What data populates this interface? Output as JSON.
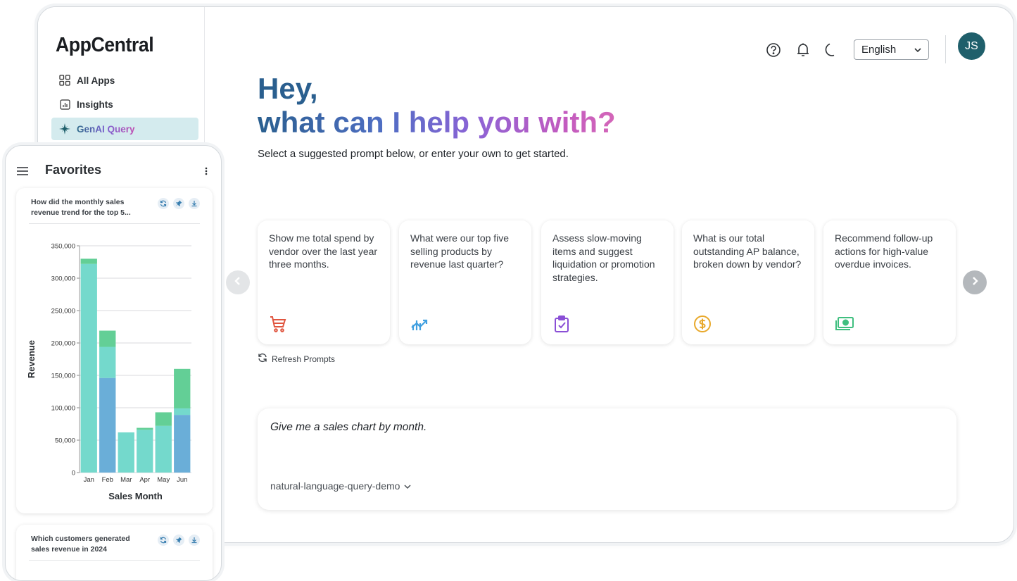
{
  "app": {
    "name": "AppCentral"
  },
  "sidebar": {
    "items": [
      {
        "label": "All Apps",
        "icon": "grid-icon"
      },
      {
        "label": "Insights",
        "icon": "chart-icon"
      },
      {
        "label": "GenAI Query",
        "icon": "sparkle-icon",
        "active": true
      }
    ]
  },
  "header": {
    "language": "English",
    "avatar_initials": "JS",
    "icons": [
      "help-icon",
      "bell-icon",
      "moon-icon"
    ]
  },
  "hero": {
    "greeting_line1": "Hey,",
    "greeting_line2": "what can I help you with?",
    "subtitle": "Select a suggested prompt below, or enter your own to get started."
  },
  "prompts": [
    {
      "text": "Show me total spend by vendor over the last year three months.",
      "icon": "cart-icon",
      "color": "#e0553f"
    },
    {
      "text": "What were our top five selling products by revenue last quarter?",
      "icon": "trend-icon",
      "color": "#3f9fe0"
    },
    {
      "text": "Assess slow-moving items and suggest liquidation or promotion strategies.",
      "icon": "clipboard-check-icon",
      "color": "#8a4fd6"
    },
    {
      "text": "What is our total outstanding AP balance, broken down by vendor?",
      "icon": "dollar-icon",
      "color": "#e8a82a"
    },
    {
      "text": "Recommend follow-up actions for high-value overdue invoices.",
      "icon": "cash-icon",
      "color": "#3fbf7f"
    }
  ],
  "refresh_label": "Refresh Prompts",
  "query": {
    "text": "Give me a sales chart by month.",
    "model": "natural-language-query-demo"
  },
  "favorites": {
    "title": "Favorites",
    "cards": [
      {
        "question": "How did the monthly sales revenue trend for the top 5..."
      },
      {
        "question": "Which customers generated sales revenue in 2024"
      }
    ]
  },
  "chart_data": {
    "type": "bar",
    "stacked": true,
    "categories": [
      "Jan",
      "Feb",
      "Mar",
      "Apr",
      "May",
      "Jun"
    ],
    "series": [
      {
        "values": [
          0,
          146000,
          0,
          0,
          0,
          89000
        ],
        "color": "#6aaed8"
      },
      {
        "values": [
          322000,
          48000,
          62000,
          66000,
          72000,
          10000
        ],
        "color": "#74d9cc"
      },
      {
        "values": [
          8000,
          25000,
          0,
          3000,
          21000,
          61000
        ],
        "color": "#63cf96"
      }
    ],
    "xlabel": "Sales Month",
    "ylabel": "Revenue",
    "ylim": [
      0,
      350000
    ],
    "yticks": [
      "350,000",
      "300,000",
      "250,000",
      "200,000",
      "150,000",
      "100,000",
      "50,000",
      "0"
    ],
    "grid": true
  }
}
